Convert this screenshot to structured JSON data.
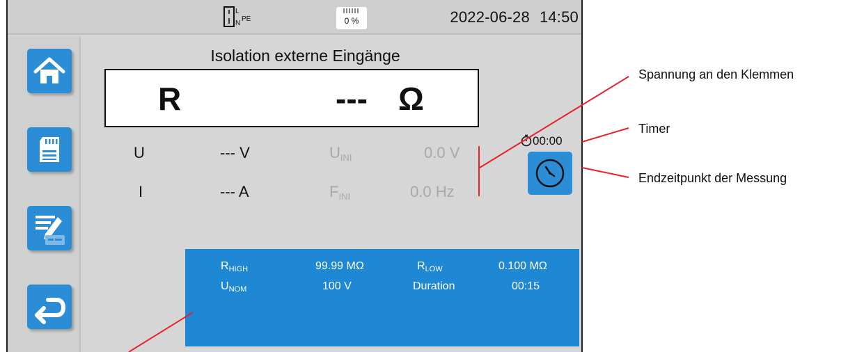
{
  "status_bar": {
    "date": "2022-06-28",
    "time": "14:50",
    "battery_percent": "0 %",
    "wiring_labels": {
      "l": "L",
      "n": "N",
      "pe": "PE"
    }
  },
  "sidebar": {
    "items": [
      {
        "name": "home",
        "icon": "home-icon"
      },
      {
        "name": "memory",
        "icon": "sd-card-icon"
      },
      {
        "name": "settings",
        "icon": "parameters-icon"
      },
      {
        "name": "back",
        "icon": "back-arrow-icon"
      }
    ]
  },
  "main": {
    "title": "Isolation externe Eingänge",
    "result": {
      "label": "R",
      "value": "---",
      "unit": "Ω"
    },
    "readings": {
      "u_label": "U",
      "u_value": "--- V",
      "i_label": "I",
      "i_value": "--- A",
      "uini_main": "U",
      "uini_sub": "INI",
      "uini_value": "0.0 V",
      "fini_main": "F",
      "fini_sub": "INI",
      "fini_value": "0.0 Hz"
    },
    "timer": "00:00"
  },
  "parameters": {
    "rhigh_main": "R",
    "rhigh_sub": "HIGH",
    "rhigh_value": "99.99 MΩ",
    "rlow_main": "R",
    "rlow_sub": "LOW",
    "rlow_value": "0.100 MΩ",
    "unom_main": "U",
    "unom_sub": "NOM",
    "unom_value": "100 V",
    "duration_label": "Duration",
    "duration_value": "00:15"
  },
  "callouts": {
    "voltage": "Spannung an den Klemmen",
    "timer": "Timer",
    "end_time": "Endzeitpunkt der Messung"
  },
  "colors": {
    "accent": "#2b8dd6",
    "panel": "#1e88d5",
    "callout_line": "#e8202a"
  }
}
